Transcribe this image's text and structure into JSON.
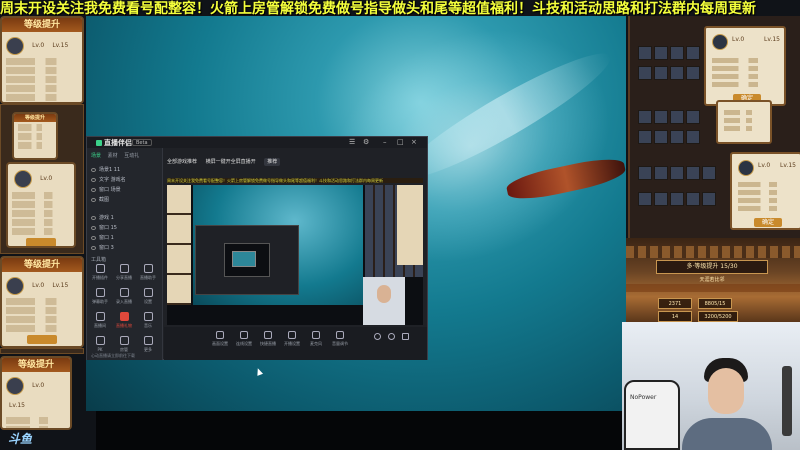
{
  "marquee": {
    "text": "周末开设关注我免费看号配整容！火箭上房管解锁免费做号指导做头和尾等超值福利！斗技和活动思路和打法群内每周更新"
  },
  "left_panels": {
    "banner_label": "等级提升",
    "lv_from": "Lv.0",
    "lv_to": "Lv.15"
  },
  "right_panel": {
    "card1": {
      "lv_from": "Lv.0",
      "lv_to": "Lv.15",
      "confirm": "确定"
    },
    "card2": {
      "lv_from": "Lv.0",
      "lv_to": "Lv.15",
      "confirm": "确定"
    }
  },
  "tavern": {
    "board": "多·等级提升 15/30",
    "subtitle": "天涯若比邻",
    "stats": [
      "2371",
      "8805/15",
      "14",
      "3200/5200"
    ]
  },
  "webcam": {
    "chair_text": "NoPower"
  },
  "logo": {
    "text": "斗鱼"
  },
  "obs": {
    "app_name": "直播伴侣",
    "badge": "Beta",
    "left_tabs": [
      "场景",
      "素材",
      "互动礼"
    ],
    "scene_items": [
      "场景1 11",
      "文字 游戏名",
      "窗口 场景",
      "截图",
      "游戏 1",
      "窗口 15",
      "窗口 1",
      "窗口 3"
    ],
    "tools_header": "工具箱",
    "tools": [
      {
        "label": "开播插件"
      },
      {
        "label": "分享直播"
      },
      {
        "label": "直播助手"
      },
      {
        "label": "弹幕助手"
      },
      {
        "label": "录入直播"
      },
      {
        "label": "设置"
      },
      {
        "label": "直播间"
      },
      {
        "label": "直播礼物"
      },
      {
        "label": "音乐"
      },
      {
        "label": "PK"
      },
      {
        "label": "房管"
      },
      {
        "label": "更多"
      }
    ],
    "footer_hint": "心动直播请立即前往下载",
    "main_tabs": [
      "全部游戏推荐",
      "横屏一键开全屏直播开",
      "推荐"
    ],
    "bottom_tools": [
      "画面设置",
      "连线设置",
      "快捷直播",
      "开播设置",
      "麦克风",
      "音量调节"
    ],
    "mini_marquee": "周末开设关注我免费看号配整容！火箭上房管解锁免费做号指导做头和尾等超值福利！斗技和活动思路和打法群内每周更新"
  }
}
